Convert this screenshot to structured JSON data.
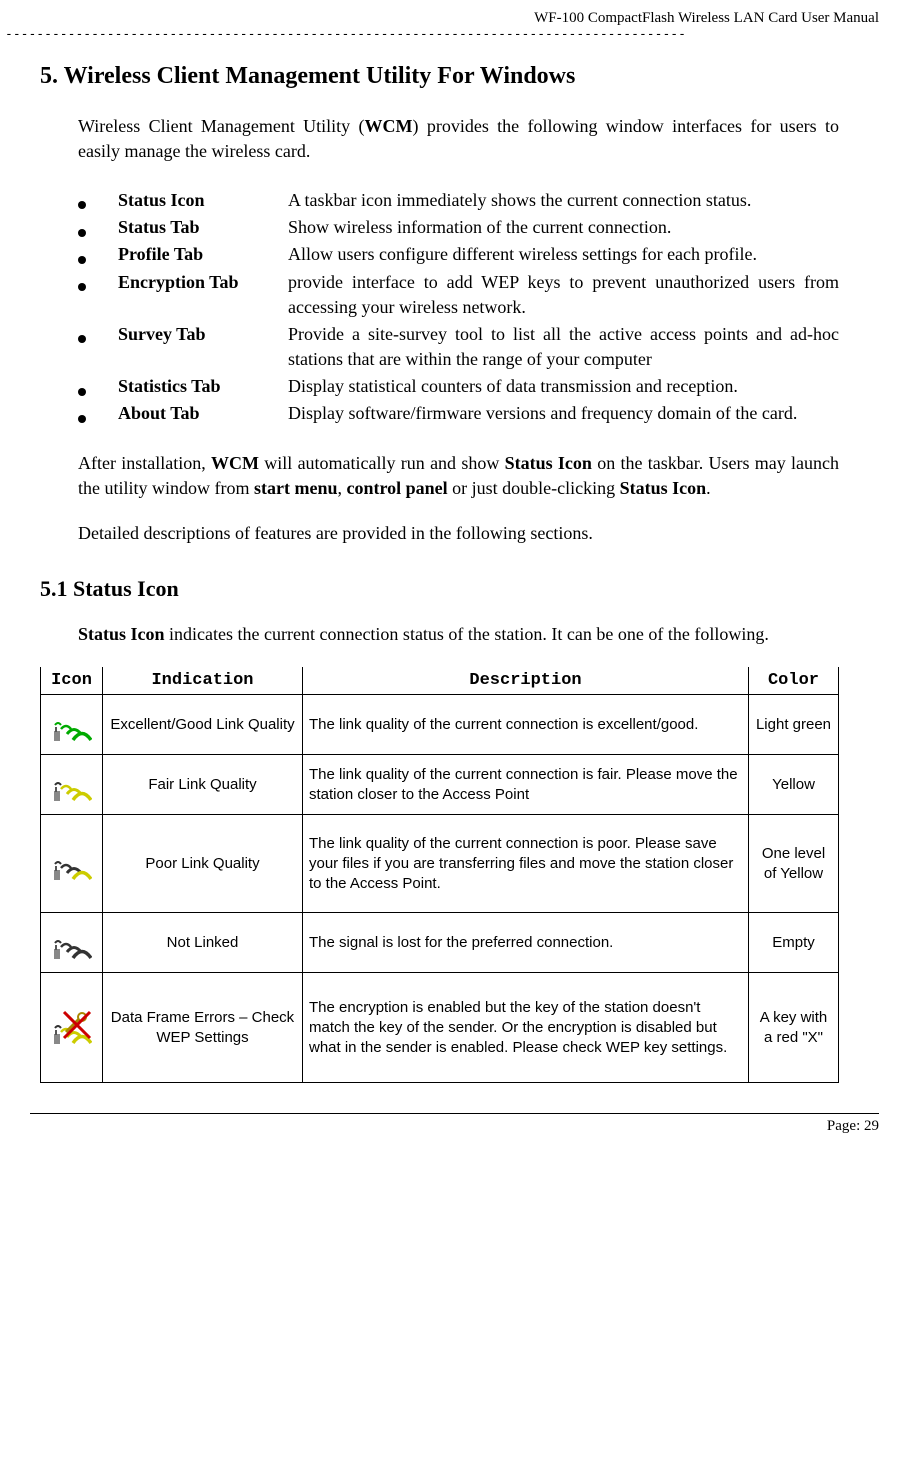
{
  "header": {
    "doc_title": "WF-100 CompactFlash Wireless LAN Card User Manual",
    "dash_line": "---------------------------------------------------------------------------------------"
  },
  "section": {
    "number": "5.",
    "title": "Wireless Client Management Utility For Windows",
    "intro_before": "Wireless Client Management Utility (",
    "intro_wcm": "WCM",
    "intro_after": ") provides the following window interfaces for users to easily manage the wireless card."
  },
  "features": [
    {
      "label": "Status Icon",
      "desc": "A taskbar icon immediately shows the current connection status."
    },
    {
      "label": "Status Tab",
      "desc": "Show wireless information of the current connection."
    },
    {
      "label": "Profile Tab",
      "desc": "Allow users configure different wireless settings for each profile."
    },
    {
      "label": "Encryption Tab",
      "desc": "provide interface to add WEP keys to prevent unauthorized users from accessing your wireless network."
    },
    {
      "label": "Survey Tab",
      "desc": "Provide a site-survey tool to list all the active access points and ad-hoc stations that are within the range of your computer"
    },
    {
      "label": "Statistics Tab",
      "desc": "Display statistical counters of data transmission and reception."
    },
    {
      "label": "About Tab",
      "desc": "Display software/firmware versions and frequency domain of the card."
    }
  ],
  "after_install": {
    "p1a": "After installation, ",
    "p1_wcm": "WCM",
    "p1b": " will automatically run and show ",
    "p1_status_icon": "Status Icon",
    "p1c": " on the taskbar. Users may launch the utility window from ",
    "p1_start": "start menu",
    "p1_comma": ", ",
    "p1_control": "control panel",
    "p1d": " or just double-clicking ",
    "p1_status_icon2": "Status Icon",
    "p1e": ".",
    "p2": "Detailed descriptions of features are provided in the following sections."
  },
  "subsection": {
    "number": "5.1",
    "title": "Status Icon",
    "p_before": "",
    "p_bold": "Status Icon",
    "p_after": " indicates the current connection status of the station. It can be one of the following."
  },
  "table": {
    "headers": {
      "icon": "Icon",
      "indication": "Indication",
      "description": "Description",
      "color": "Color"
    },
    "rows": [
      {
        "icon_name": "signal-excellent-icon",
        "indication": "Excellent/Good Link Quality",
        "description": "The link quality of the current connection is excellent/good.",
        "color": "Light green"
      },
      {
        "icon_name": "signal-fair-icon",
        "indication": "Fair Link Quality",
        "description": "The link quality of the current connection is fair. Please move the station closer to the Access Point",
        "color": "Yellow"
      },
      {
        "icon_name": "signal-poor-icon",
        "indication": "Poor Link Quality",
        "description": "The link quality of the current connection is poor. Please save your files if you are transferring files and move the station closer to the Access Point.",
        "color": "One level of Yellow"
      },
      {
        "icon_name": "signal-not-linked-icon",
        "indication": "Not Linked",
        "description": "The signal is lost for the preferred connection.",
        "color": "Empty"
      },
      {
        "icon_name": "signal-wep-error-icon",
        "indication": "Data Frame Errors – Check WEP Settings",
        "description": "The encryption is enabled but the key of the station doesn't match the key of the sender. Or the encryption is disabled but what in the sender is enabled. Please check WEP key settings.",
        "color": "A key with a red \"X\""
      }
    ]
  },
  "footer": {
    "page_label": "Page: 29"
  }
}
